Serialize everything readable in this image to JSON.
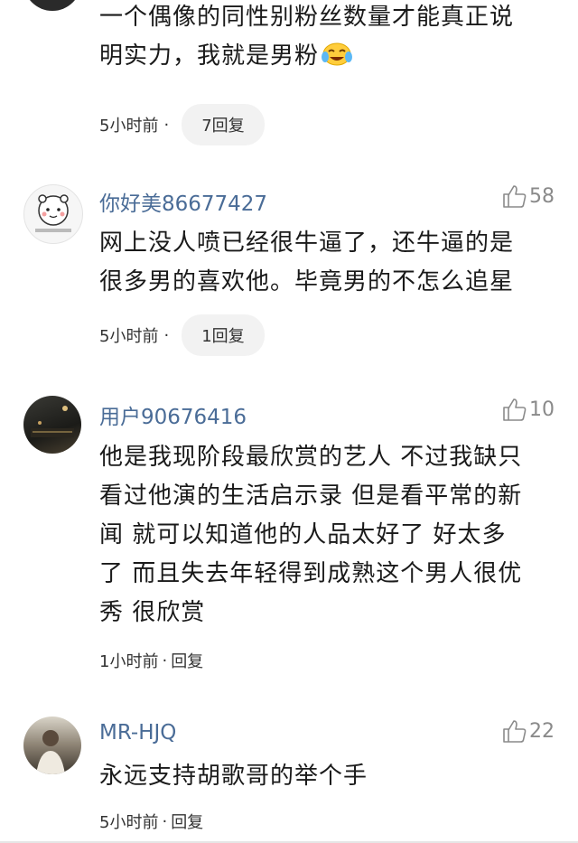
{
  "comments": [
    {
      "content_lines": [
        "一个偶像的同性别粉丝数量才能真正说",
        "明实力，我就是男粉"
      ],
      "time": "5小时前",
      "separator": "·",
      "reply_label": "7回复",
      "emoji": "laughing-crying-emoji"
    },
    {
      "username": "你好美86677427",
      "likes": "58",
      "content_lines": [
        "网上没人喷已经很牛逼了，还牛逼的是",
        "很多男的喜欢他。毕竟男的不怎么追星"
      ],
      "time": "5小时前",
      "separator": "·",
      "reply_label": "1回复",
      "avatar_icon": "cartoon-bear-avatar"
    },
    {
      "username": "用户90676416",
      "likes": "10",
      "content_lines": [
        "他是我现阶段最欣赏的艺人 不过我缺只",
        "看过他演的生活启示录 但是看平常的新",
        "闻 就可以知道他的人品太好了 好太多",
        "了 而且失去年轻得到成熟这个男人很优",
        "秀 很欣赏"
      ],
      "time": "1小时前",
      "separator": "·",
      "reply_label": "回复",
      "avatar_icon": "night-street-avatar"
    },
    {
      "username": "MR-HJQ",
      "likes": "22",
      "content_lines": [
        "永远支持胡歌哥的举个手"
      ],
      "time": "5小时前",
      "separator": "·",
      "reply_label": "回复",
      "avatar_icon": "person-photo-avatar"
    }
  ],
  "colors": {
    "username": "#4a6c97",
    "like": "#8a8a8a",
    "reply_pill_bg": "#f2f2f2"
  }
}
